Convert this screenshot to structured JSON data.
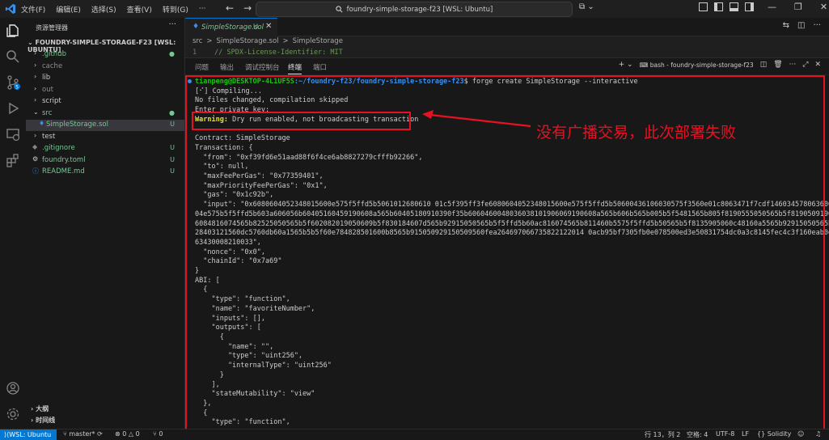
{
  "titlebar": {
    "menus": [
      "文件(F)",
      "编辑(E)",
      "选择(S)",
      "查看(V)",
      "转到(G)",
      "···"
    ],
    "search": "foundry-simple-storage-f23 [WSL: Ubuntu]"
  },
  "sidebar": {
    "title": "资源管理器",
    "root": "FOUNDRY-SIMPLE-STORAGE-F23 [WSL: UBUNTU]",
    "items": [
      {
        "label": ".github",
        "status": "●"
      },
      {
        "label": "cache",
        "status": ""
      },
      {
        "label": "lib",
        "status": ""
      },
      {
        "label": "out",
        "status": ""
      },
      {
        "label": "script",
        "status": ""
      },
      {
        "label": "src",
        "status": "●"
      },
      {
        "label": "SimpleStorage.sol",
        "status": "U"
      },
      {
        "label": "test",
        "status": ""
      },
      {
        "label": ".gitignore",
        "status": "U"
      },
      {
        "label": "foundry.toml",
        "status": "U"
      },
      {
        "label": "README.md",
        "status": "U"
      }
    ],
    "outline": "大纲",
    "timeline": "时间线"
  },
  "editor": {
    "tab_label": "SimpleStorage.sol",
    "tab_status": "U",
    "breadcrumb": [
      "src",
      ">",
      "SimpleStorage.sol",
      ">",
      "SimpleStorage"
    ],
    "line_number": "1",
    "line_text": "// SPDX-License-Identifier: MIT"
  },
  "panel": {
    "tabs": [
      "问题",
      "输出",
      "调试控制台",
      "终端",
      "端口"
    ],
    "active_tab": "终端",
    "shell_label": "bash - foundry-simple-storage-f23"
  },
  "terminal": {
    "prompt_user": "tianpeng@DESKTOP-4L1UF5S",
    "prompt_path": ":~/foundry-f23/foundry-simple-storage-f23",
    "command": "$ forge create SimpleStorage --interactive",
    "compiling": "[⠊] Compiling...",
    "no_changes": "No files changed, compilation skipped",
    "enter_key": "Enter private key:",
    "warning_label": "Warning:",
    "warning_text": " Dry run enabled, not broadcasting transaction",
    "body": "\nContract: SimpleStorage\nTransaction: {\n  \"from\": \"0xf39fd6e51aad88f6f4ce6ab8827279cfffb92266\",\n  \"to\": null,\n  \"maxFeePerGas\": \"0x77359401\",\n  \"maxPriorityFeePerGas\": \"0x1\",\n  \"gas\": \"0x1c92b\",\n  \"input\": \"0x6080604052348015600e575f5ffd5b5061012680610 01c5f395ff3fe6080604052348015600e575f5ffd5b50600436106030575f3560e01c8063471f7cdf14603457806360057361d146\n04e575b5f5ffd5b603a606056b60405160459190608a565b60405180910390f35b6060460048036038101906069190608a565b606b565b005b5f5481565b805f8190555050565b5f819050919050565b\n6084816074565b82525050565b5f602082019050609b5f830184607d565b92915050565b5f5ffd5b60ac816074565b811460b5575f5ffd5b50565b5f8135905060c48160a5565b92915050565b5f60208\n28403121560dc5760db60a1565b5b5f60e784828501600b8565b915050929150509560fea264697066735822122014 0acb95bf7305fb0e078500ed3e50831754dc0a3c8145fec4c3f160eab0e16e564736f6c\n63430008210033\",\n  \"nonce\": \"0x0\",\n  \"chainId\": \"0x7a69\"\n}\nABI: [\n  {\n    \"type\": \"function\",\n    \"name\": \"favoriteNumber\",\n    \"inputs\": [],\n    \"outputs\": [\n      {\n        \"name\": \"\",\n        \"type\": \"uint256\",\n        \"internalType\": \"uint256\"\n      }\n    ],\n    \"stateMutability\": \"view\"\n  },\n  {\n    \"type\": \"function\","
  },
  "annotation": "没有广播交易，此次部署失败",
  "statusbar": {
    "remote": "WSL: Ubuntu",
    "branch": "master*",
    "errors": "⊗ 0 △ 0",
    "ports": "⑂ 0",
    "position": "行 13，列 2",
    "spaces": "空格: 4",
    "encoding": "UTF-8",
    "eol": "LF",
    "language": "Solidity"
  },
  "colors": {
    "accent": "#0078d4",
    "annotation_red": "#e81123",
    "warning_yellow": "#e5e510",
    "prompt_green": "#16c60c"
  }
}
